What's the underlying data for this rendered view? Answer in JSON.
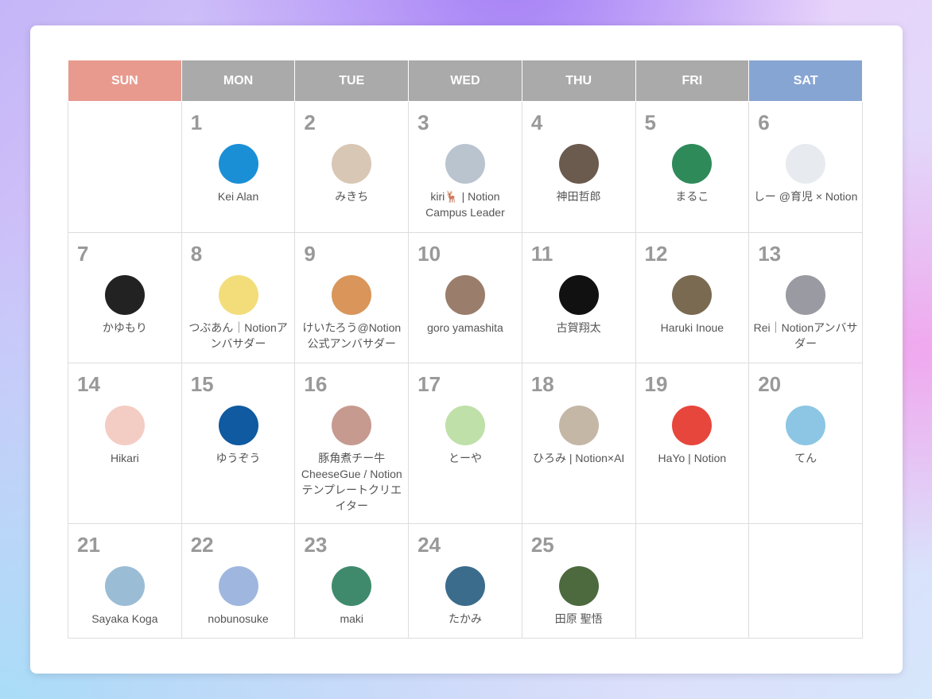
{
  "header": {
    "days": [
      "SUN",
      "MON",
      "TUE",
      "WED",
      "THU",
      "FRI",
      "SAT"
    ],
    "colors": [
      "#e89a8e",
      "#aaaaaa",
      "#aaaaaa",
      "#aaaaaa",
      "#aaaaaa",
      "#aaaaaa",
      "#87a5d3"
    ]
  },
  "weeks": [
    [
      null,
      {
        "day": "1",
        "name": "Kei Alan",
        "color": "#1a8fd6"
      },
      {
        "day": "2",
        "name": "みきち",
        "color": "#d9c7b5"
      },
      {
        "day": "3",
        "name": "kiri🦌 | Notion Campus Leader",
        "color": "#b9c4cf"
      },
      {
        "day": "4",
        "name": "神田哲郎",
        "color": "#6b5a4e"
      },
      {
        "day": "5",
        "name": "まるこ",
        "color": "#2f8a5a"
      },
      {
        "day": "6",
        "name": "しー @育児 × Notion",
        "color": "#e7ebef"
      }
    ],
    [
      {
        "day": "7",
        "name": "かゆもり",
        "color": "#222222"
      },
      {
        "day": "8",
        "name": "つぶあん｜Notionアンバサダー",
        "color": "#f3dd7a"
      },
      {
        "day": "9",
        "name": "けいたろう@Notion公式アンバサダー",
        "color": "#d9955a"
      },
      {
        "day": "10",
        "name": "goro yamashita",
        "color": "#9a7d6a"
      },
      {
        "day": "11",
        "name": "古賀翔太",
        "color": "#111111"
      },
      {
        "day": "12",
        "name": "Haruki Inoue",
        "color": "#7a6a52"
      },
      {
        "day": "13",
        "name": "Rei｜Notionアンバサダー",
        "color": "#9a9aa2"
      }
    ],
    [
      {
        "day": "14",
        "name": "Hikari",
        "color": "#f3cdc4"
      },
      {
        "day": "15",
        "name": "ゆうぞう",
        "color": "#0f5aa0"
      },
      {
        "day": "16",
        "name": "豚角煮チー牛 CheeseGue / Notionテンプレートクリエイター",
        "color": "#c79a8f"
      },
      {
        "day": "17",
        "name": "とーや",
        "color": "#bfe0a8"
      },
      {
        "day": "18",
        "name": "ひろみ | Notion×AI",
        "color": "#c4b7a6"
      },
      {
        "day": "19",
        "name": "HaYo | Notion",
        "color": "#e7463c"
      },
      {
        "day": "20",
        "name": "てん",
        "color": "#8cc6e4"
      }
    ],
    [
      {
        "day": "21",
        "name": "Sayaka Koga",
        "color": "#9bbcd5"
      },
      {
        "day": "22",
        "name": "nobunosuke",
        "color": "#9fb7de"
      },
      {
        "day": "23",
        "name": "maki",
        "color": "#3f8a6c"
      },
      {
        "day": "24",
        "name": "たかみ",
        "color": "#3b6c8c"
      },
      {
        "day": "25",
        "name": "田原 聖悟",
        "color": "#4c6a3e"
      },
      null,
      null
    ]
  ]
}
